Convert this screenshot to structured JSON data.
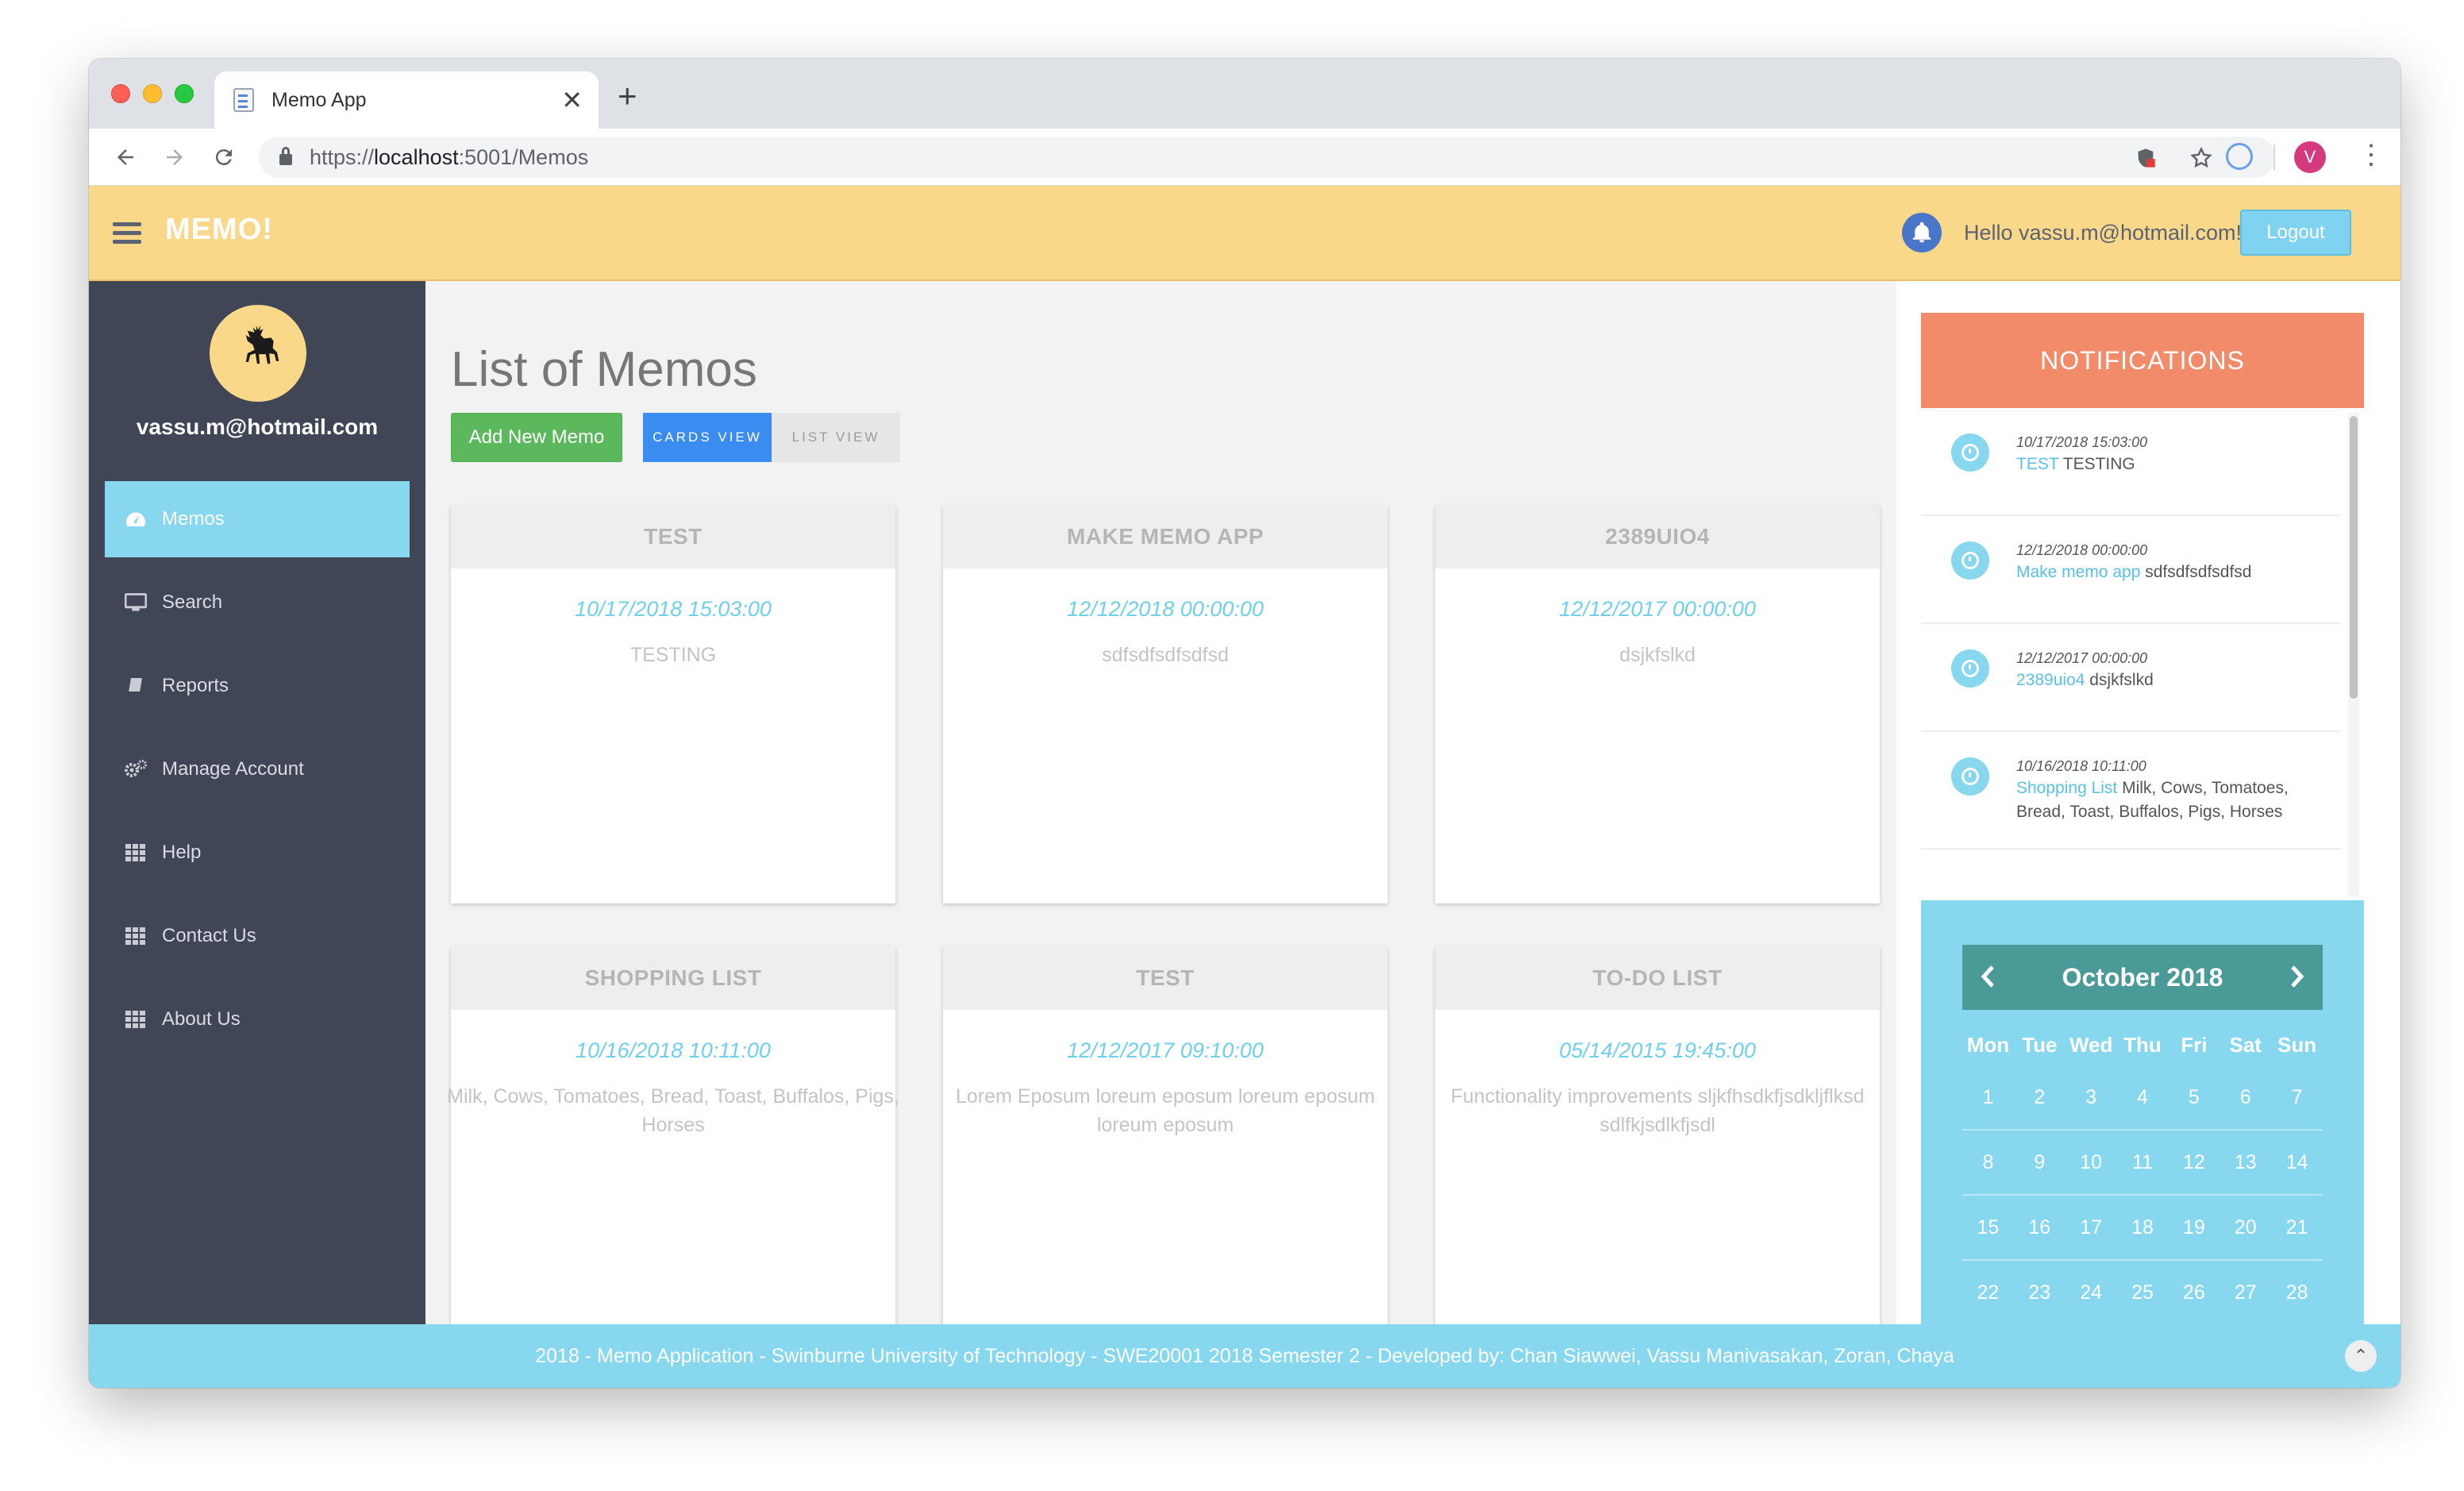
{
  "browser": {
    "tab_title": "Memo App",
    "tab_close": "✕",
    "new_tab": "+",
    "url_scheme": "https://",
    "url_host": "localhost",
    "url_path": ":5001/Memos",
    "profile_initial": "V"
  },
  "header": {
    "brand": "MEMO!",
    "greeting": "Hello vassu.m@hotmail.com!",
    "logout_label": "Logout"
  },
  "sidebar": {
    "user_email": "vassu.m@hotmail.com",
    "items": [
      {
        "label": "Memos",
        "icon": "dashboard-icon",
        "active": true
      },
      {
        "label": "Search",
        "icon": "monitor-icon"
      },
      {
        "label": "Reports",
        "icon": "book-icon"
      },
      {
        "label": "Manage Account",
        "icon": "gears-icon"
      },
      {
        "label": "Help",
        "icon": "grid-icon"
      },
      {
        "label": "Contact Us",
        "icon": "grid-icon"
      },
      {
        "label": "About Us",
        "icon": "grid-icon"
      }
    ]
  },
  "main": {
    "title": "List of Memos",
    "add_button": "Add New Memo",
    "cards_view": "CARDS VIEW",
    "list_view": "LIST VIEW",
    "memos": [
      {
        "title": "TEST",
        "date": "10/17/2018 15:03:00",
        "body": "TESTING"
      },
      {
        "title": "MAKE MEMO APP",
        "date": "12/12/2018 00:00:00",
        "body": "sdfsdfsdfsdfsd"
      },
      {
        "title": "2389UIO4",
        "date": "12/12/2017 00:00:00",
        "body": "dsjkfslkd"
      },
      {
        "title": "SHOPPING LIST",
        "date": "10/16/2018 10:11:00",
        "body": "Milk, Cows, Tomatoes, Bread, Toast, Buffalos, Pigs, Horses"
      },
      {
        "title": "TEST",
        "date": "12/12/2017 09:10:00",
        "body": "Lorem Eposum loreum eposum loreum eposum loreum eposum"
      },
      {
        "title": "TO-DO LIST",
        "date": "05/14/2015 19:45:00",
        "body": "Functionality improvements sljkfhsdkfjsdkljflksd sdlfkjsdlkfjsdl"
      }
    ]
  },
  "notifications": {
    "heading": "NOTIFICATIONS",
    "items": [
      {
        "time": "10/17/2018 15:03:00",
        "title": "TEST",
        "text": " TESTING"
      },
      {
        "time": "12/12/2018 00:00:00",
        "title": "Make memo app",
        "text": " sdfsdfsdfsdfsd"
      },
      {
        "time": "12/12/2017 00:00:00",
        "title": "2389uio4",
        "text": " dsjkfslkd"
      },
      {
        "time": "10/16/2018 10:11:00",
        "title": "Shopping List",
        "text": " Milk, Cows, Tomatoes, Bread, Toast, Buffalos, Pigs, Horses"
      }
    ]
  },
  "calendar": {
    "month_label": "October 2018",
    "prev": "‹",
    "next": "›",
    "weekdays": [
      "Mon",
      "Tue",
      "Wed",
      "Thu",
      "Fri",
      "Sat",
      "Sun"
    ],
    "weeks": [
      [
        "1",
        "2",
        "3",
        "4",
        "5",
        "6",
        "7"
      ],
      [
        "8",
        "9",
        "10",
        "11",
        "12",
        "13",
        "14"
      ],
      [
        "15",
        "16",
        "17",
        "18",
        "19",
        "20",
        "21"
      ],
      [
        "22",
        "23",
        "24",
        "25",
        "26",
        "27",
        "28"
      ]
    ]
  },
  "footer": {
    "text": "2018 - Memo Application - Swinburne University of Technology - SWE20001 2018 Semester 2 - Developed by: Chan Siawwei, Vassu Manivasakan, Zoran, Chaya",
    "to_top": "⌃"
  }
}
